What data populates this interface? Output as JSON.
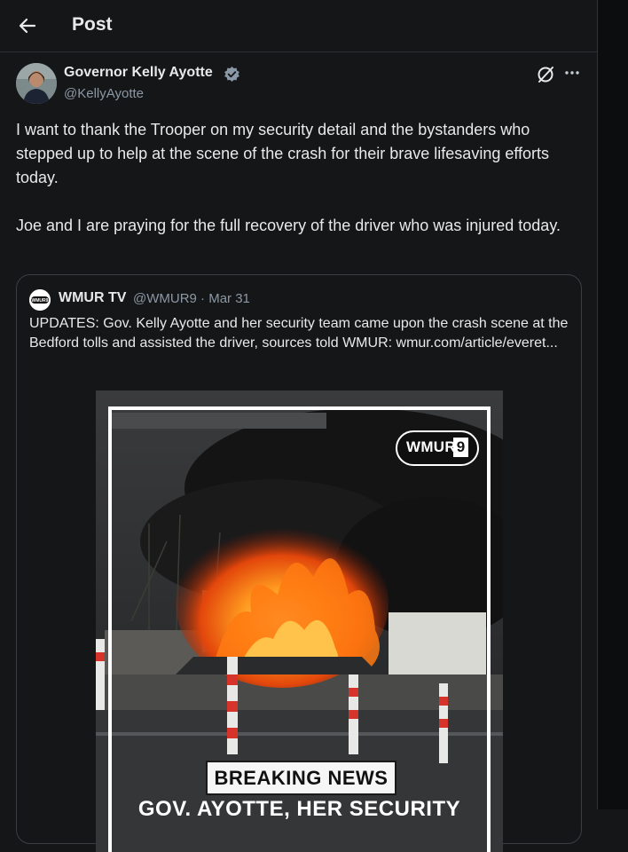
{
  "header": {
    "title": "Post"
  },
  "post": {
    "author_name": "Governor Kelly Ayotte",
    "author_handle": "@KellyAyotte",
    "paragraphs": [
      "I want to thank the Trooper on my security detail and the bystanders who stepped up to help at the scene of the crash for their brave lifesaving efforts today.",
      "Joe and I are praying for the full recovery of the driver who was injured today."
    ]
  },
  "quote": {
    "avatar_text": "WMUR9",
    "name": "WMUR TV",
    "meta": "@WMUR9 · Mar 31",
    "text": "UPDATES: Gov. Kelly Ayotte and her security team came upon the crash scene at the Bedford tolls and assisted the driver, sources told WMUR: wmur.com/article/everet...",
    "media": {
      "logo": "WMUR",
      "logo_digit": "9",
      "banner": "BREAKING NEWS",
      "headline": "GOV. AYOTTE, HER SECURITY"
    }
  },
  "icons": {
    "back": "arrow-left-icon",
    "verified": "verified-badge-icon",
    "grok": "grok-icon",
    "more": "more-dots-icon"
  },
  "colors": {
    "background": "#151618",
    "text": "#e7e9ea",
    "muted": "#8b98a5",
    "border": "#3a3f44",
    "fire": "#ff6a00"
  }
}
